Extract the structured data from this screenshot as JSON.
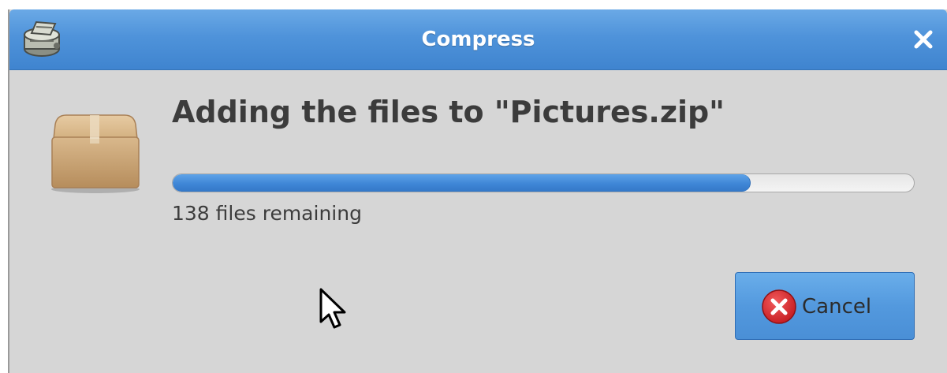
{
  "window": {
    "title": "Compress",
    "title_icon": "archive-manager-icon",
    "close_icon": "close-icon"
  },
  "content": {
    "icon": "package-box-icon",
    "heading": "Adding the files to \"Pictures.zip\"",
    "progress": 0.78,
    "status": "138 files remaining"
  },
  "actions": {
    "cancel_label": "Cancel",
    "cancel_icon": "cancel-icon"
  },
  "colors": {
    "titlebar": "#4f93da",
    "progress_fill": "#3f86d6",
    "window_bg": "#d6d6d6",
    "cancel_icon_red": "#d9262a"
  }
}
